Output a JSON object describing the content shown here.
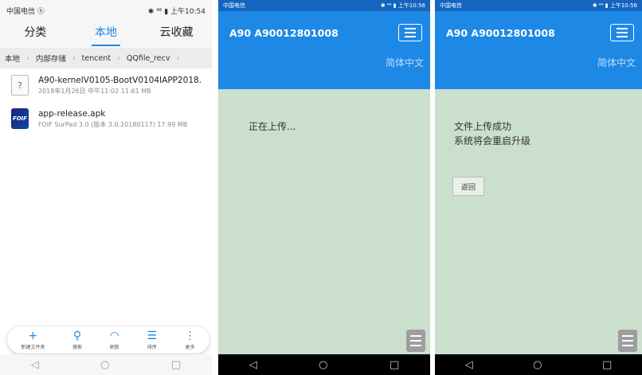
{
  "left": {
    "status": {
      "carrier": "中国电信 ⓗ",
      "right": "✱ ⁴⁶ ▮ 上午10:54"
    },
    "tabs": [
      "分类",
      "本地",
      "云收藏"
    ],
    "breadcrumb": [
      "本地",
      "内部存储",
      "tencent",
      "QQfile_recv"
    ],
    "files": [
      {
        "name": "A90-kernelV0105-BootV0104IAPP2018...",
        "meta": "2018年1月26日 中午11:02 11.61 MB"
      },
      {
        "name": "app-release.apk",
        "meta": "FOIF SurPad 3.0 (版本 3.0.20180117) 17.99 MB"
      }
    ],
    "app_icon_text": "FOIF",
    "toolbar": [
      {
        "icon": "+",
        "label": "新建文件夹"
      },
      {
        "icon": "⚲",
        "label": "搜索"
      },
      {
        "icon": "◠",
        "label": "刷新"
      },
      {
        "icon": "☰",
        "label": "排序"
      },
      {
        "icon": "⋮",
        "label": "更多"
      }
    ],
    "nav": [
      "◁",
      "○",
      "□"
    ]
  },
  "middle": {
    "status": {
      "carrier": "中国电信",
      "right": "✱ ⁴⁶ ▮ 上午10:56"
    },
    "model": "A90  A90012801008",
    "lang": "简体中文",
    "message": "正在上传...",
    "nav": [
      "◁",
      "○",
      "□"
    ]
  },
  "right": {
    "status": {
      "carrier": "中国电信",
      "right": "✱ ⁴⁶ ▮ 上午10:56"
    },
    "model": "A90  A90012801008",
    "lang": "简体中文",
    "message1": "文件上传成功",
    "message2": "系统将会重启升级",
    "back_label": "返回",
    "nav": [
      "◁",
      "○",
      "□"
    ]
  }
}
